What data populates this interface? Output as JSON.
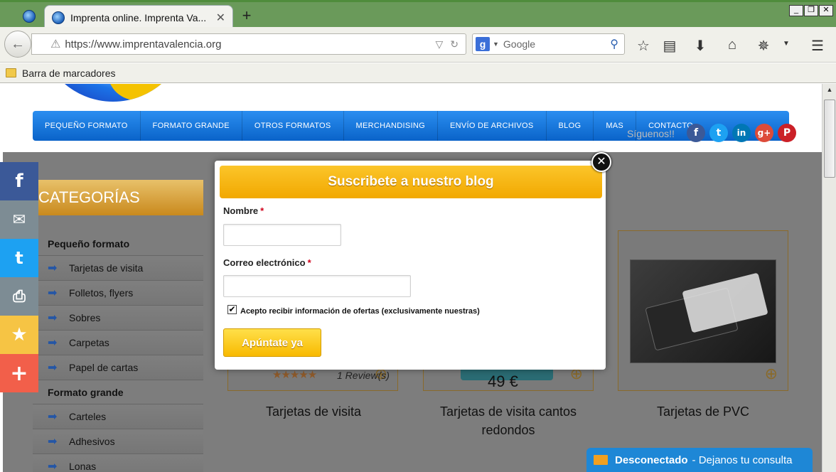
{
  "browser": {
    "tab_title": "Imprenta online. Imprenta Va...",
    "url": "https://www.imprentavalencia.org",
    "search_placeholder": "Google",
    "bookmarks_folder": "Barra de marcadores"
  },
  "nav": {
    "items": [
      "PEQUEÑO FORMATO",
      "FORMATO GRANDE",
      "OTROS FORMATOS",
      "MERCHANDISING",
      "ENVÍO DE ARCHIVOS",
      "BLOG",
      "MAS",
      "CONTACTO"
    ],
    "follow_text": "Síguenos!!"
  },
  "sidebar": {
    "heading": "CATEGORÍAS",
    "group1_title": "Pequeño formato",
    "group1_items": [
      "Tarjetas de visita",
      "Folletos, flyers",
      "Sobres",
      "Carpetas",
      "Papel de cartas"
    ],
    "group2_title": "Formato grande",
    "group2_items": [
      "Carteles",
      "Adhesivos",
      "Lonas"
    ]
  },
  "products": [
    {
      "name": "Tarjetas de visita"
    },
    {
      "name": "Tarjetas de visita cantos redondos"
    },
    {
      "name": "Tarjetas de PVC"
    }
  ],
  "product_meta": {
    "reviews": "1 Review(s)",
    "price": "49 €"
  },
  "modal": {
    "title": "Suscribete a nuestro blog",
    "name_label": "Nombre",
    "email_label": "Correo electrónico",
    "required_mark": "*",
    "checkbox_label": "Acepto recibir información de ofertas (exclusivamente nuestras)",
    "checkbox_checked": true,
    "submit_label": "Apúntate ya"
  },
  "chat": {
    "status": "Desconectado",
    "message": "- Dejanos tu consulta"
  },
  "colors": {
    "nav_blue": "#0a63c9",
    "modal_yellow": "#f2a800",
    "facebook": "#3b5998",
    "email": "#7d8c94",
    "twitter": "#1da1f2",
    "print": "#7d8c94",
    "favorite": "#f6c444",
    "more": "#f25f4a",
    "chat_blue": "#1e87d6"
  }
}
